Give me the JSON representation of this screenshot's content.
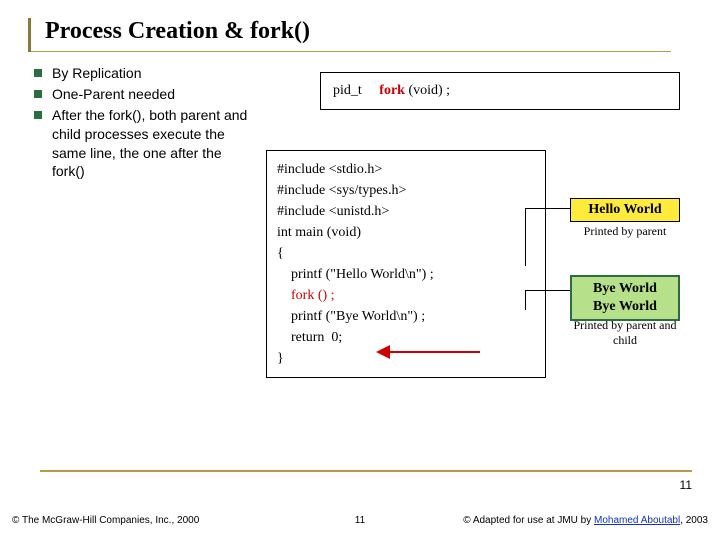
{
  "title": "Process Creation & fork()",
  "bullets": {
    "items": [
      {
        "text": "By Replication"
      },
      {
        "text": "One-Parent needed"
      },
      {
        "text": "After the fork(), both parent and child processes execute the same line, the one after the fork()"
      }
    ]
  },
  "signature": {
    "ret": "pid_t",
    "name": "fork",
    "args": "(void) ;"
  },
  "code": {
    "inc1": "#include <stdio.h>",
    "inc2": "#include <sys/types.h>",
    "inc3": "#include <unistd.h>",
    "blank1": " ",
    "main": "int main (void)",
    "open": "{",
    "p1": "    printf (\"Hello World\\n\") ;",
    "blank2": " ",
    "forkline": "    fork () ;",
    "blank3": " ",
    "p2": "    printf (\"Bye World\\n\") ;",
    "blank4": " ",
    "ret": "    return  0;",
    "close": "}"
  },
  "outputs": {
    "hello": "Hello World",
    "hello_caption": "Printed by parent",
    "bye1": "Bye World",
    "bye2": "Bye World",
    "bye_caption": "Printed by parent and child"
  },
  "footer": {
    "left": "© The McGraw-Hill Companies, Inc., 2000",
    "center": "11",
    "right_prefix": "© Adapted for use at JMU by ",
    "right_link": "Mohamed Aboutabl",
    "right_suffix": ", 2003",
    "pagenum": "11"
  }
}
